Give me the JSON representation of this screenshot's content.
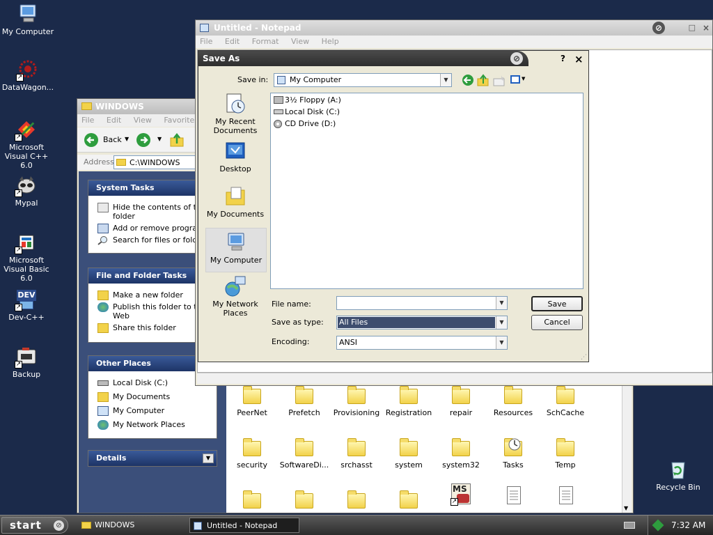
{
  "desktop": {
    "icons": [
      {
        "label": "My Computer"
      },
      {
        "label": "DataWagon..."
      },
      {
        "label": "Microsoft Visual C++ 6.0"
      },
      {
        "label": "Mypal"
      },
      {
        "label": "Microsoft Visual Basic 6.0"
      },
      {
        "label": "Dev-C++"
      },
      {
        "label": "Backup"
      },
      {
        "label": "Recycle Bin"
      }
    ],
    "devcpp_logo_text": "DEV"
  },
  "explorer": {
    "title": "WINDOWS",
    "menu": [
      "File",
      "Edit",
      "View",
      "Favorites"
    ],
    "back_label": "Back",
    "address_label": "Address",
    "address_value": "C:\\WINDOWS",
    "system_tasks": {
      "header": "System Tasks",
      "items": [
        "Hide the contents of this folder",
        "Add or remove programs",
        "Search for files or folders"
      ]
    },
    "file_tasks": {
      "header": "File and Folder Tasks",
      "items": [
        "Make a new folder",
        "Publish this folder to the Web",
        "Share this folder"
      ]
    },
    "other_places": {
      "header": "Other Places",
      "items": [
        "Local Disk (C:)",
        "My Documents",
        "My Computer",
        "My Network Places"
      ]
    },
    "details_header": "Details",
    "folders_row1": [
      "PeerNet",
      "Prefetch",
      "Provisioning",
      "Registration",
      "repair",
      "Resources",
      "SchCache"
    ],
    "folders_row2": [
      "security",
      "SoftwareDi...",
      "srchasst",
      "system",
      "system32",
      "Tasks",
      "Temp"
    ],
    "msi_badge": "MS"
  },
  "notepad": {
    "title": "Untitled - Notepad",
    "menu": [
      "File",
      "Edit",
      "Format",
      "View",
      "Help"
    ]
  },
  "save_dialog": {
    "title": "Save As",
    "help_glyph": "?",
    "close_glyph": "×",
    "save_in_label": "Save in:",
    "save_in_value": "My Computer",
    "places": [
      "My Recent Documents",
      "Desktop",
      "My Documents",
      "My Computer",
      "My Network Places"
    ],
    "drives": [
      "3½ Floppy (A:)",
      "Local Disk (C:)",
      "CD Drive (D:)"
    ],
    "file_name_label": "File name:",
    "file_name_value": "",
    "save_type_label": "Save as type:",
    "save_type_value": "All Files",
    "encoding_label": "Encoding:",
    "encoding_value": "ANSI",
    "save_button": "Save",
    "cancel_button": "Cancel"
  },
  "taskbar": {
    "start_label": "start",
    "buttons": [
      "WINDOWS",
      "Untitled - Notepad"
    ],
    "clock": "7:32 AM"
  },
  "colors": {
    "desktop_bg": "#1b2a4a",
    "pane_header": "#1d3466",
    "selection": "#3d4d6e",
    "taskbar": "#2c2c2c"
  }
}
